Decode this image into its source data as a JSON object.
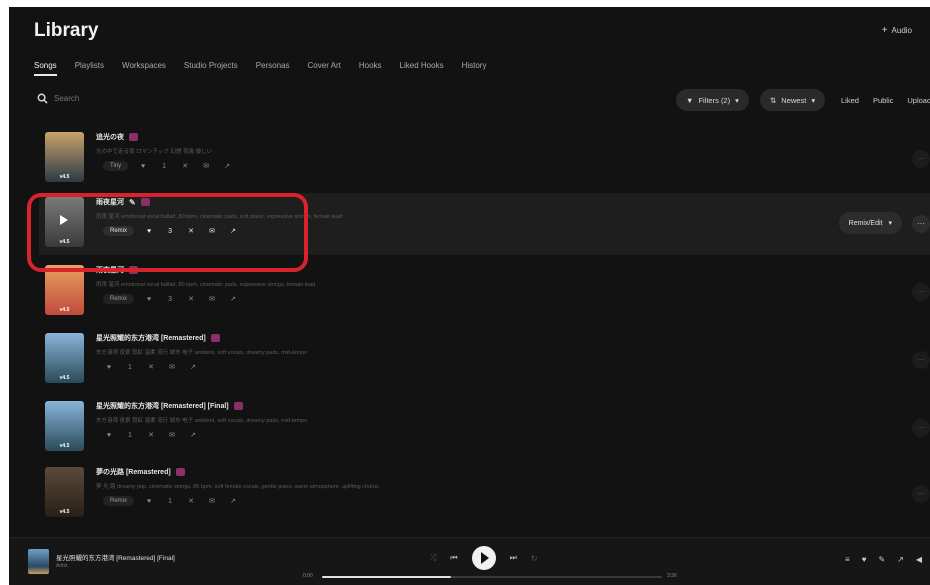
{
  "header": {
    "title": "Library",
    "add_label": "Audio",
    "add_icon": "plus-icon"
  },
  "tabs": [
    "Songs",
    "Playlists",
    "Workspaces",
    "Studio Projects",
    "Personas",
    "Cover Art",
    "Hooks",
    "Liked Hooks",
    "History"
  ],
  "search": {
    "placeholder": "Search"
  },
  "filters": {
    "filter_label": "Filters (2)",
    "sort_label": "Newest",
    "view_links": [
      "Liked",
      "Public",
      "Uploads"
    ]
  },
  "songs": [
    {
      "title": "追光の夜",
      "desc": "光の中で走る夜 ロマンチック 幻想 夜風 優しい",
      "version": "v4.5",
      "chip": "Tiny",
      "likes": "1",
      "thumb_top": "#c9a26a",
      "thumb_bottom": "#2a3a46"
    },
    {
      "title": "雨夜星河",
      "desc": "雨夜 星河 emotional vocal ballad, 80 bpm, cinematic pads, soft piano, expressive strings, female lead",
      "version": "v4.5",
      "chip": "Remix",
      "likes": "3",
      "thumb_top": "#7a7a7a",
      "thumb_bottom": "#3a3a3a",
      "remix_label": "Remix/Edit"
    },
    {
      "title": "雨夜星河",
      "desc": "雨夜 星河 emotional vocal ballad, 80 bpm, cinematic pads, expressive strings, female lead",
      "version": "v4.5",
      "chip": "Remix",
      "likes": "3",
      "thumb_top": "#e8a060",
      "thumb_bottom": "#c04a3a"
    },
    {
      "title": "星光照耀的东方港湾 [Remastered]",
      "desc": "东方港湾 夜景 霓虹 温柔 流行 城市 电子 ambient, soft vocals, dreamy pads, mid-tempo",
      "version": "v4.5",
      "chip": "",
      "likes": "1",
      "thumb_top": "#8ab4d8",
      "thumb_bottom": "#2a4a5a"
    },
    {
      "title": "星光照耀的东方港湾 [Remastered] [Final]",
      "desc": "东方港湾 夜景 霓虹 温柔 流行 城市 电子 ambient, soft vocals, dreamy pads, mid-tempo",
      "version": "v4.5",
      "chip": "",
      "likes": "1",
      "thumb_top": "#8ab4d8",
      "thumb_bottom": "#2a4a5a"
    },
    {
      "title": "夢の光路 [Remastered]",
      "desc": "夢 光 路 dreamy pop, cinematic strings, 85 bpm, soft female vocals, gentle piano, warm atmosphere, uplifting chorus",
      "version": "v4.5",
      "chip": "Remix",
      "likes": "1",
      "thumb_top": "#5a4a3a",
      "thumb_bottom": "#2a2018"
    }
  ],
  "player": {
    "title": "星光照耀的东方港湾 [Remastered] [Final]",
    "artist": "Artist",
    "time_elapsed": "0:00",
    "time_total": "3:36",
    "progress": 0.38
  }
}
